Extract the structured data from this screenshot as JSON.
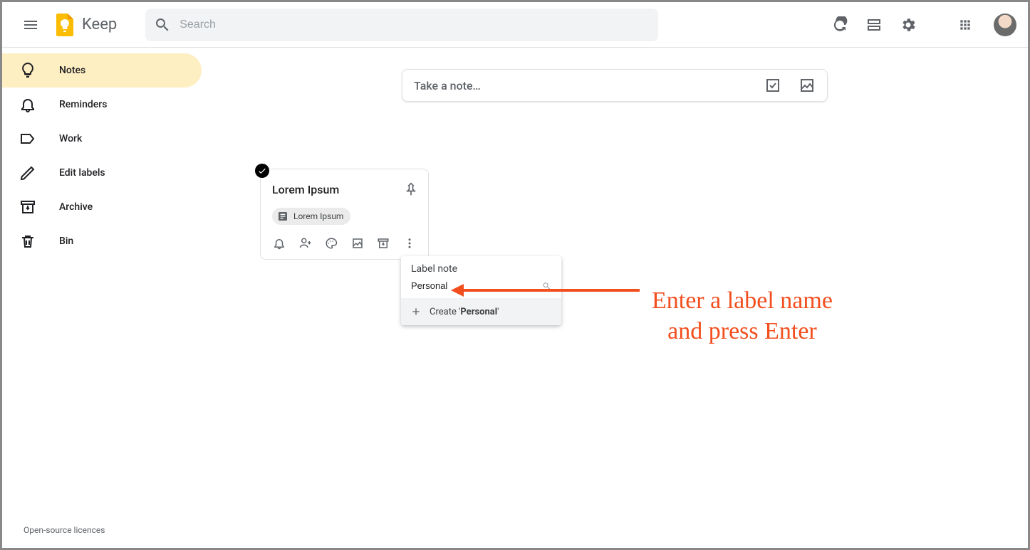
{
  "header": {
    "app_name": "Keep",
    "search_placeholder": "Search"
  },
  "sidebar": {
    "items": [
      {
        "label": "Notes",
        "icon": "bulb",
        "active": true
      },
      {
        "label": "Reminders",
        "icon": "bell",
        "active": false
      },
      {
        "label": "Work",
        "icon": "tag",
        "active": false
      },
      {
        "label": "Edit labels",
        "icon": "pencil",
        "active": false
      },
      {
        "label": "Archive",
        "icon": "archive",
        "active": false
      },
      {
        "label": "Bin",
        "icon": "trash",
        "active": false
      }
    ],
    "footer": "Open-source licences"
  },
  "take_note": {
    "placeholder": "Take a note…"
  },
  "note": {
    "title": "Lorem Ipsum",
    "chip_label": "Lorem Ipsum"
  },
  "label_popup": {
    "title": "Label note",
    "input_value": "Personal",
    "create_prefix": "Create ",
    "create_quote_open": "'",
    "create_name": "Personal",
    "create_quote_close": "'"
  },
  "annotation": {
    "line1": "Enter a label name",
    "line2": "and press Enter"
  }
}
